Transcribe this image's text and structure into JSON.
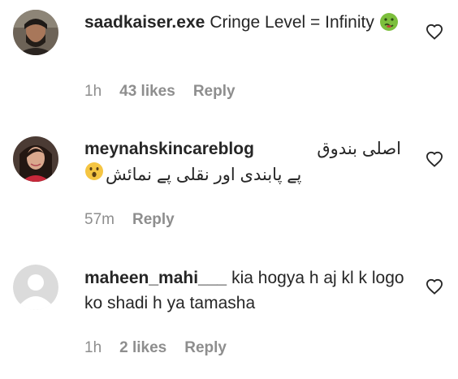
{
  "comments": [
    {
      "username": "saadkaiser.exe",
      "text": "Cringe Level = Infinity",
      "emoji": "nauseated-face",
      "time": "1h",
      "likes": "43 likes",
      "reply": "Reply"
    },
    {
      "username": "meynahskincareblog",
      "text_line1": "اصلی بندوق",
      "text_line2": "پے پابندی اور نقلی پے نمائش",
      "emoji": "astonished-face",
      "time": "57m",
      "reply": "Reply"
    },
    {
      "username": "maheen_mahi___",
      "text": "kia hogya h aj kl k logo ko shadi h ya tamasha",
      "time": "1h",
      "likes": "2 likes",
      "reply": "Reply"
    }
  ],
  "icons": {
    "like": "heart-outline-icon"
  },
  "colors": {
    "text": "#262626",
    "meta": "#8e8e8e",
    "emoji_green": "#7cbf3c",
    "emoji_yellow": "#f5c542"
  }
}
